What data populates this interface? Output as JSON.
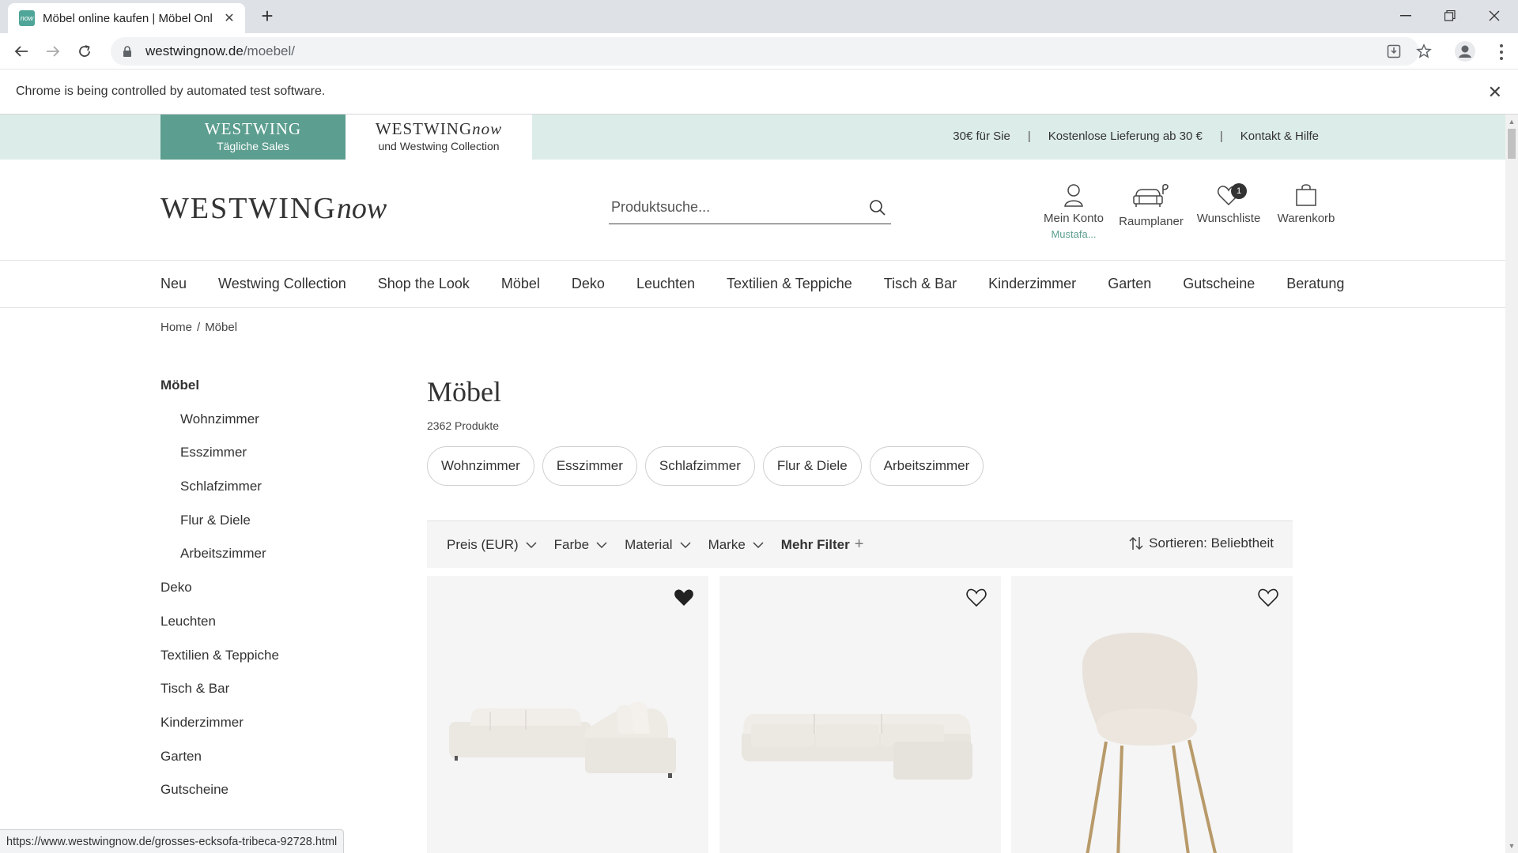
{
  "browser": {
    "tab_title": "Möbel online kaufen | Möbel Onl",
    "favicon_text": "now",
    "url_host": "westwingnow.de",
    "url_path": "/moebel/",
    "infobar_text": "Chrome is being controlled by automated test software.",
    "status_url": "https://www.westwingnow.de/grosses-ecksofa-tribeca-92728.html"
  },
  "topbar": {
    "tab1_brand": "WESTWING",
    "tab1_sub": "Tägliche Sales",
    "tab2_brand": "WESTWING",
    "tab2_brand_script": "now",
    "tab2_sub": "und Westwing Collection",
    "links": [
      "30€ für Sie",
      "Kostenlose Lieferung ab 30 €",
      "Kontakt & Hilfe"
    ]
  },
  "header": {
    "logo_main": "WESTWING",
    "logo_script": "now",
    "search_placeholder": "Produktsuche...",
    "account_label": "Mein Konto",
    "account_user": "Mustafa...",
    "roomplanner_label": "Raumplaner",
    "wishlist_label": "Wunschliste",
    "wishlist_count": "1",
    "cart_label": "Warenkorb"
  },
  "nav": [
    "Neu",
    "Westwing Collection",
    "Shop the Look",
    "Möbel",
    "Deko",
    "Leuchten",
    "Textilien & Teppiche",
    "Tisch & Bar",
    "Kinderzimmer",
    "Garten",
    "Gutscheine",
    "Beratung"
  ],
  "breadcrumb": {
    "home": "Home",
    "current": "Möbel"
  },
  "sidebar": {
    "active": "Möbel",
    "subitems": [
      "Wohnzimmer",
      "Esszimmer",
      "Schlafzimmer",
      "Flur & Diele",
      "Arbeitszimmer"
    ],
    "items": [
      "Deko",
      "Leuchten",
      "Textilien & Teppiche",
      "Tisch & Bar",
      "Kinderzimmer",
      "Garten",
      "Gutscheine"
    ]
  },
  "content": {
    "title": "Möbel",
    "count": "2362 Produkte",
    "pills": [
      "Wohnzimmer",
      "Esszimmer",
      "Schlafzimmer",
      "Flur & Diele",
      "Arbeitszimmer"
    ]
  },
  "filters": {
    "items": [
      "Preis (EUR)",
      "Farbe",
      "Material",
      "Marke"
    ],
    "more": "Mehr Filter",
    "sort": "Sortieren: Beliebtheit"
  },
  "products": [
    {
      "name": "corner-sofa",
      "wishlisted": true
    },
    {
      "name": "modular-sofa",
      "wishlisted": false
    },
    {
      "name": "upholstered-chair",
      "wishlisted": false
    }
  ],
  "colors": {
    "accent": "#5c9e8f",
    "topbar_bg": "#dcece8"
  }
}
